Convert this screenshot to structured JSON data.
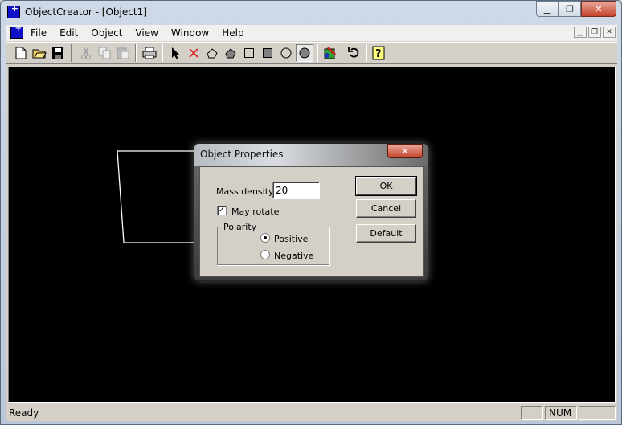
{
  "window": {
    "title": "ObjectCreator - [Object1]"
  },
  "menu": {
    "items": [
      "File",
      "Edit",
      "Object",
      "View",
      "Window",
      "Help"
    ]
  },
  "toolbar": {
    "buttons": [
      "new-file-icon",
      "open-folder-icon",
      "save-icon",
      "cut-icon",
      "copy-icon",
      "paste-icon",
      "print-icon",
      "select-arrow-icon",
      "delete-x-icon",
      "polygon-outline-icon",
      "polygon-filled-icon",
      "rectangle-outline-icon",
      "rectangle-filled-icon",
      "circle-outline-icon",
      "circle-filled-icon",
      "paint-icon",
      "rotate-icon",
      "help-icon"
    ],
    "pressed": "circle-filled-icon"
  },
  "dialog": {
    "title": "Object Properties",
    "mass_density_label": "Mass density:",
    "mass_density_value": "20",
    "may_rotate_label": "May rotate",
    "may_rotate_checked": true,
    "polarity_label": "Polarity",
    "polarity_options": [
      "Positive",
      "Negative"
    ],
    "polarity_selected": "Positive",
    "ok_label": "OK",
    "cancel_label": "Cancel",
    "default_label": "Default"
  },
  "statusbar": {
    "text": "Ready",
    "num": "NUM"
  },
  "colors": {
    "canvas": "#000000",
    "shape_stroke": "#ffffff",
    "dialog_face": "#d4d0c8"
  }
}
